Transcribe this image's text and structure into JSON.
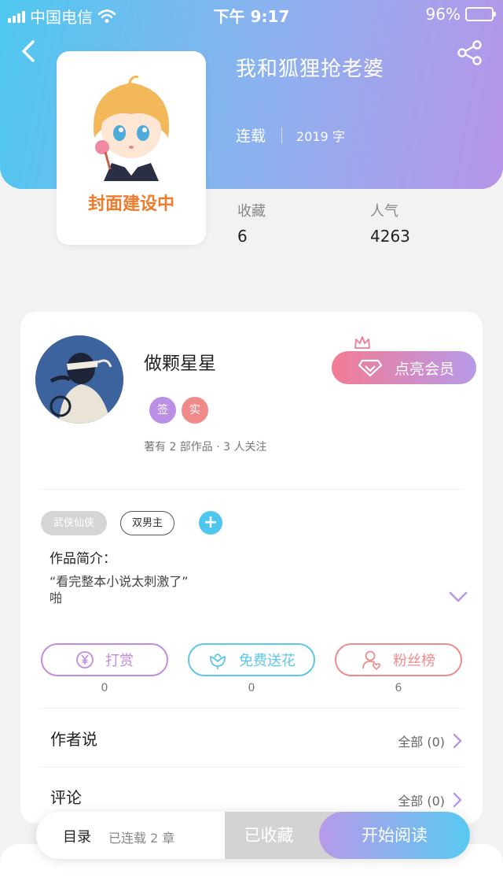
{
  "status_bar": {
    "carrier": "中国电信",
    "time": "下午 9:17",
    "battery": "96%"
  },
  "book": {
    "title": "我和狐狸抢老婆",
    "status": "连载",
    "word_count": "2019 字",
    "cover_caption": "封面建设中",
    "stats": [
      {
        "label": "收藏",
        "value": "6"
      },
      {
        "label": "人气",
        "value": "4263"
      }
    ]
  },
  "author": {
    "name": "做颗星星",
    "badges": [
      "签",
      "实"
    ],
    "stats": "著有 2 部作品 · 3 人关注",
    "vip_button": "点亮会员"
  },
  "tags": [
    "武侠仙侠",
    "双男主"
  ],
  "add_tag_symbol": "+",
  "intro": {
    "label": "作品简介：",
    "text": "“看完整本小说太刺激了”\n啪"
  },
  "actions": [
    {
      "label": "打赏",
      "count": "0",
      "icon": "yen-coin-icon",
      "color": "#c28be3"
    },
    {
      "label": "免费送花",
      "count": "0",
      "icon": "flower-icon",
      "color": "#5cc7ea"
    },
    {
      "label": "粉丝榜",
      "count": "6",
      "icon": "fan-user-icon",
      "color": "#ef8b8b"
    }
  ],
  "author_says": {
    "label": "作者说",
    "link": "全部 (0)"
  },
  "comments": {
    "label": "评论",
    "link": "全部 (0)"
  },
  "bottom_bar": {
    "toc_label": "目录",
    "chapters": "已连载 2 章",
    "collected_label": "已收藏",
    "read_label": "开始阅读"
  },
  "colors": {
    "accent_blue": "#4fc8f0",
    "accent_purple": "#b795e8",
    "vip_pink": "#f27b93"
  }
}
